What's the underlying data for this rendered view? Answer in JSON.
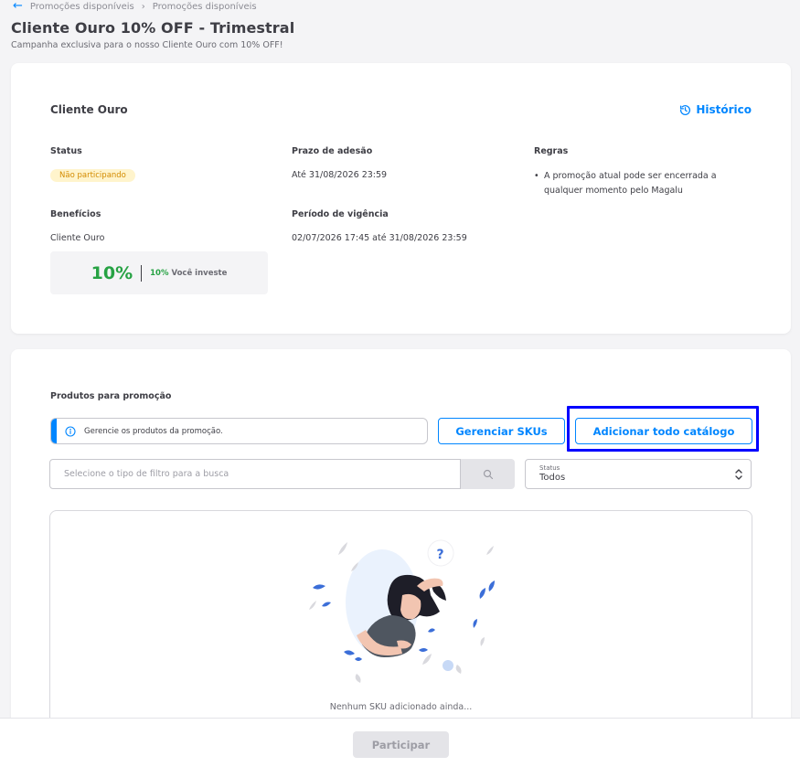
{
  "breadcrumb": {
    "items": [
      "Promoções disponíveis",
      "Promoções disponíveis"
    ]
  },
  "page": {
    "title": "Cliente Ouro 10% OFF - Trimestral",
    "subtitle": "Campanha exclusiva para o nosso Cliente Ouro com 10% OFF!"
  },
  "details": {
    "title": "Cliente Ouro",
    "history_label": "Histórico",
    "status_label": "Status",
    "status_value": "Não participando",
    "deadline_label": "Prazo de adesão",
    "deadline_value": "Até 31/08/2026 23:59",
    "rules_label": "Regras",
    "rules": [
      "A promoção atual pode ser encerrada a qualquer momento pelo Magalu"
    ],
    "benefits_label": "Benefícios",
    "benefits_name": "Cliente Ouro",
    "benefit_percent": "10%",
    "benefit_invest_percent": "10%",
    "benefit_invest_text": "Você investe",
    "period_label": "Período de vigência",
    "period_value": "02/07/2026 17:45 até 31/08/2026 23:59"
  },
  "products": {
    "title": "Produtos para promoção",
    "info_text": "Gerencie os produtos da promoção.",
    "manage_skus_label": "Gerenciar SKUs",
    "add_catalog_label": "Adicionar todo catálogo",
    "search_placeholder": "Selecione o tipo de filtro para a busca",
    "status_label": "Status",
    "status_value": "Todos",
    "empty_text": "Nenhum SKU adicionado ainda..."
  },
  "footer": {
    "participate_label": "Participar"
  },
  "colors": {
    "primary": "#0086ff",
    "success": "#27a244",
    "warning_bg": "#fff4cc",
    "warning_text": "#d38b00",
    "highlight": "#0000ff"
  }
}
